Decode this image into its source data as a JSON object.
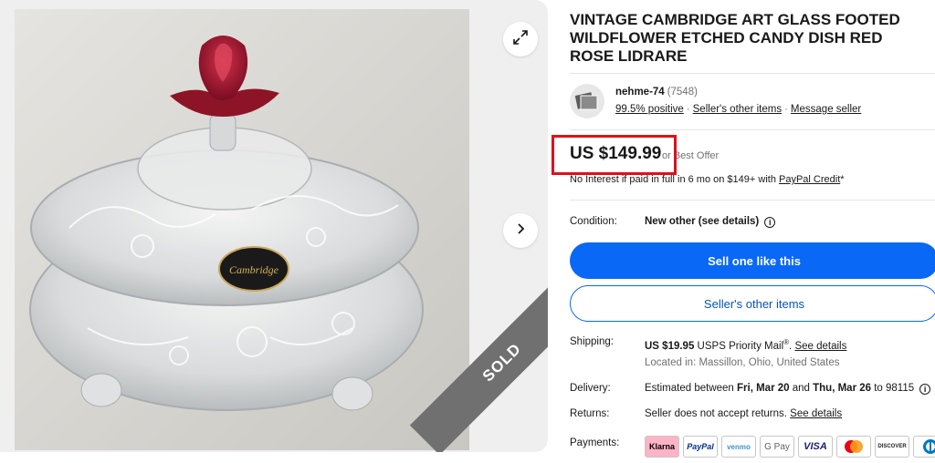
{
  "listing": {
    "title": "VINTAGE CAMBRIDGE ART GLASS FOOTED WILDFLOWER ETCHED CANDY DISH RED ROSE LIDRARE",
    "sold_label": "SOLD",
    "label_sticker": "Cambridge"
  },
  "seller": {
    "name": "nehme-74",
    "feedback_count": "(7548)",
    "positive": "99.5% positive",
    "other_items": "Seller's other items",
    "message": "Message seller"
  },
  "price": {
    "amount": "US $149.99",
    "or": "or",
    "best_offer": "Best Offer",
    "paypal_prefix": "No Interest if paid in full in 6 mo on $149+ with ",
    "paypal_link": "PayPal Credit",
    "paypal_suffix": "*"
  },
  "condition": {
    "label": "Condition:",
    "value": "New other (see details)"
  },
  "buttons": {
    "sell_one": "Sell one like this",
    "seller_other": "Seller's other items"
  },
  "shipping": {
    "label": "Shipping:",
    "cost": "US $19.95",
    "service": " USPS Priority Mail",
    "reg": "®",
    "dot": ". ",
    "details_link": "See details",
    "location": "Located in: Massillon, Ohio, United States"
  },
  "delivery": {
    "label": "Delivery:",
    "prefix": "Estimated between ",
    "start": "Fri, Mar 20",
    "and": " and ",
    "end": "Thu, Mar 26",
    "to": " to 98115"
  },
  "returns": {
    "label": "Returns:",
    "text": "Seller does not accept returns. ",
    "link": "See details"
  },
  "payments": {
    "label": "Payments:",
    "methods": [
      "Klarna",
      "PayPal",
      "venmo",
      "G Pay",
      "VISA",
      "Mastercard",
      "DISCOVER",
      "Diners"
    ]
  },
  "colors": {
    "primary": "#0968f6",
    "highlight": "#e0101a",
    "sold_ribbon": "#707070"
  }
}
